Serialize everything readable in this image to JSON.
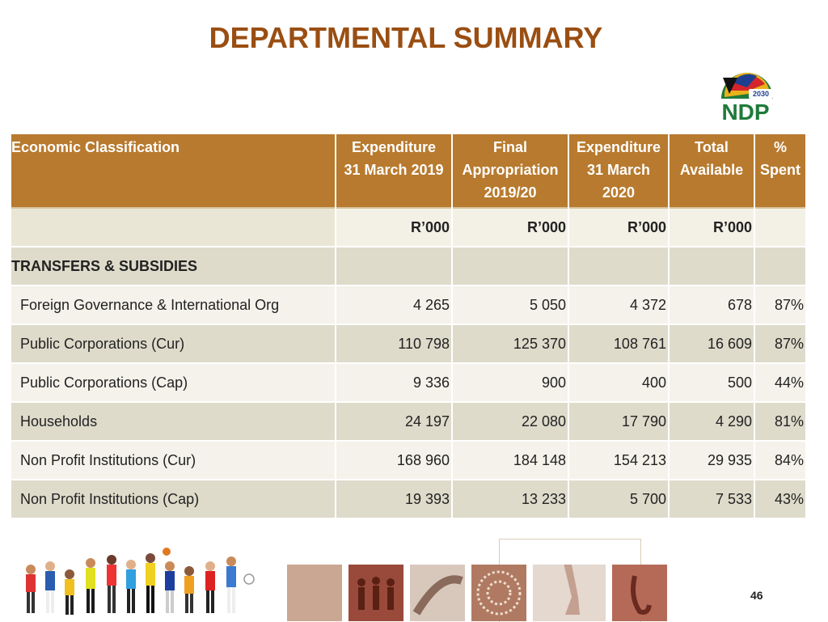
{
  "slide": {
    "title": "DEPARTMENTAL SUMMARY",
    "page_number": "46",
    "logo_text": "NDP",
    "logo_year": "2030"
  },
  "table": {
    "headers": {
      "classification": "Economic Classification",
      "expenditure_2019_line1": "Expenditure",
      "expenditure_2019_line2": "31 March 2019",
      "final_line1": "Final",
      "final_line2": "Appropriation",
      "final_line3": "2019/20",
      "expenditure_2020_line1": "Expenditure",
      "expenditure_2020_line2": "31 March",
      "expenditure_2020_line3": "2020",
      "total_line1": "Total",
      "total_line2": "Available",
      "spent_line1": "%",
      "spent_line2": "Spent"
    },
    "units": [
      "R’000",
      "R’000",
      "R’000",
      "R’000"
    ],
    "section": "TRANSFERS & SUBSIDIES",
    "rows": [
      {
        "label": "Foreign Governance & International Org",
        "exp2019": "4 265",
        "final": "5 050",
        "exp2020": "4 372",
        "total": "678",
        "spent": "87%"
      },
      {
        "label": "Public Corporations (Cur)",
        "exp2019": "110 798",
        "final": "125 370",
        "exp2020": "108 761",
        "total": "16 609",
        "spent": "87%"
      },
      {
        "label": "Public Corporations (Cap)",
        "exp2019": "9 336",
        "final": "900",
        "exp2020": "400",
        "total": "500",
        "spent": "44%"
      },
      {
        "label": "Households",
        "exp2019": "24 197",
        "final": "22 080",
        "exp2020": "17 790",
        "total": "4 290",
        "spent": "81%"
      },
      {
        "label": "Non Profit Institutions (Cur)",
        "exp2019": "168 960",
        "final": "184 148",
        "exp2020": "154 213",
        "total": "29 935",
        "spent": "84%"
      },
      {
        "label": "Non Profit Institutions (Cap)",
        "exp2019": "19 393",
        "final": "13 233",
        "exp2020": "5 700",
        "total": "7 533",
        "spent": "43%"
      }
    ]
  },
  "colors": {
    "title": "#9a4e12",
    "header_bg": "#b87a2e",
    "row_light": "#f4f2ea",
    "row_dark": "#dedbcb"
  }
}
